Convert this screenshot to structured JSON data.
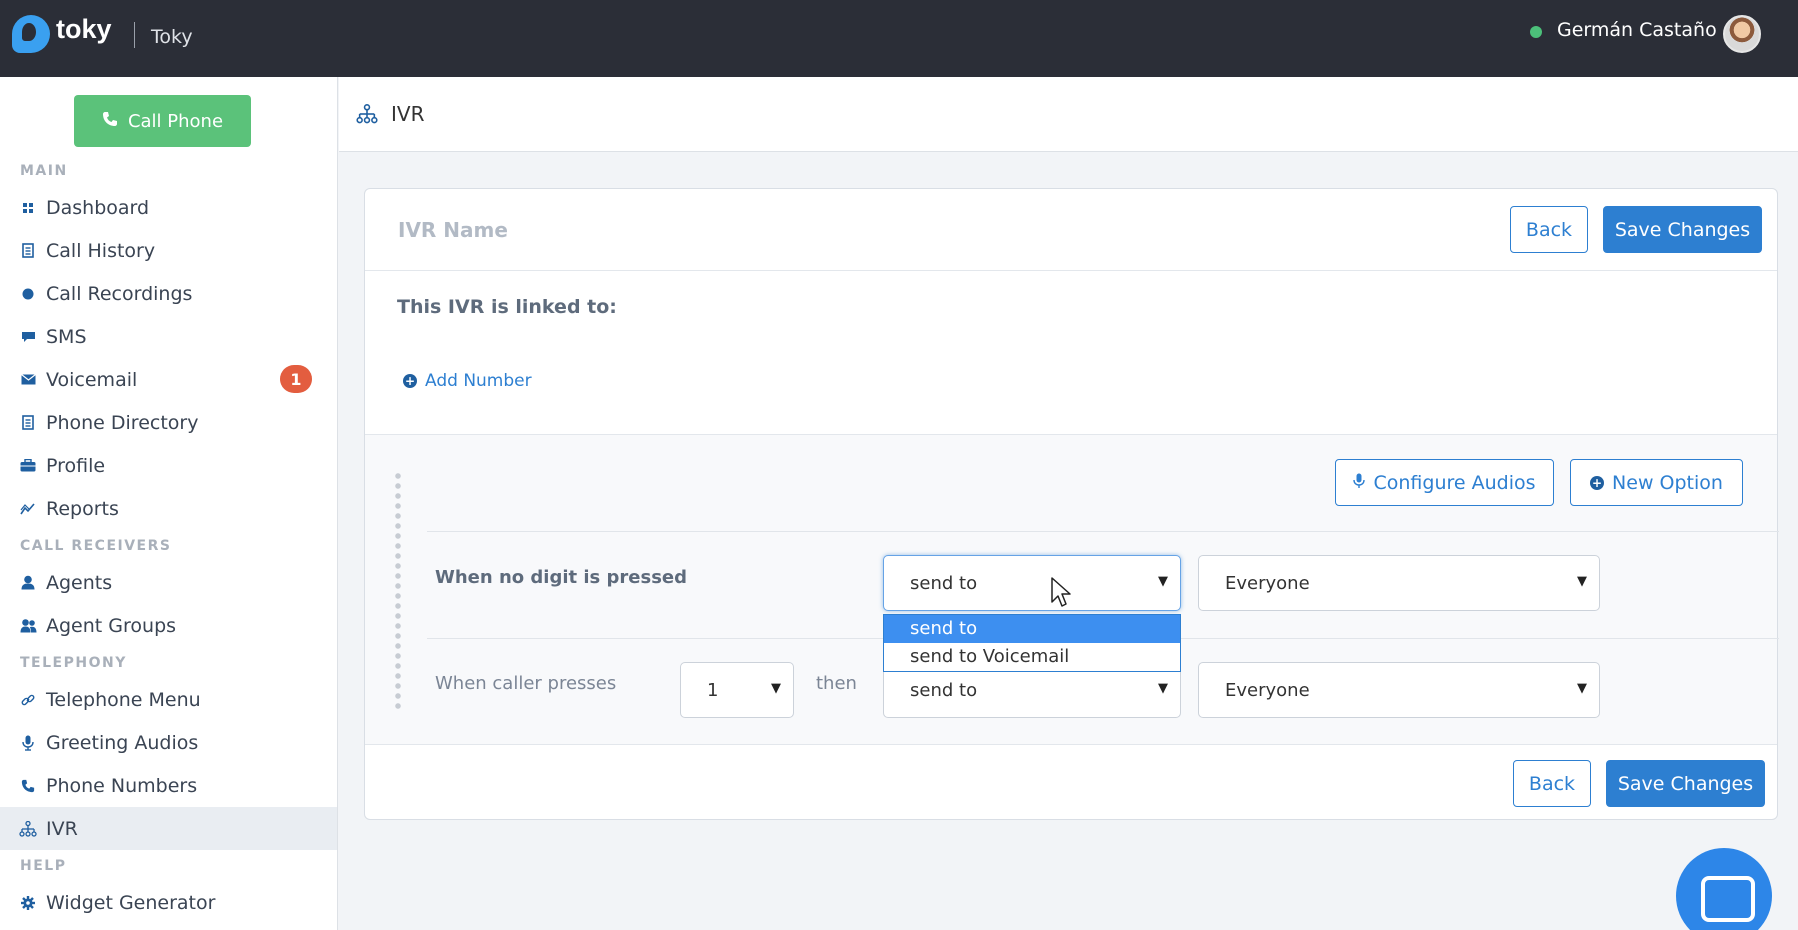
{
  "topbar": {
    "logo_text": "toky",
    "org_name": "Toky",
    "user_name": "Germán Castaño",
    "status_color": "#4cc07a"
  },
  "sidebar": {
    "call_button_label": "Call Phone",
    "sections": {
      "main": "MAIN",
      "call_receivers": "CALL RECEIVERS",
      "telephony": "TELEPHONY",
      "help": "HELP"
    },
    "items": [
      {
        "label": "Dashboard",
        "icon": "grid-icon"
      },
      {
        "label": "Call History",
        "icon": "document-icon"
      },
      {
        "label": "Call Recordings",
        "icon": "dot-icon"
      },
      {
        "label": "SMS",
        "icon": "chat-icon"
      },
      {
        "label": "Voicemail",
        "icon": "envelope-icon",
        "badge": "1"
      },
      {
        "label": "Phone Directory",
        "icon": "document-icon"
      },
      {
        "label": "Profile",
        "icon": "briefcase-icon"
      },
      {
        "label": "Reports",
        "icon": "chart-icon"
      },
      {
        "label": "Agents",
        "icon": "user-icon"
      },
      {
        "label": "Agent Groups",
        "icon": "users-icon"
      },
      {
        "label": "Telephone Menu",
        "icon": "link-icon"
      },
      {
        "label": "Greeting Audios",
        "icon": "microphone-icon"
      },
      {
        "label": "Phone Numbers",
        "icon": "phone-icon"
      },
      {
        "label": "IVR",
        "icon": "sitemap-icon",
        "active": true
      },
      {
        "label": "Widget Generator",
        "icon": "gear-icon"
      }
    ]
  },
  "page": {
    "title": "IVR"
  },
  "card": {
    "ivr_name_placeholder": "IVR Name",
    "back_label": "Back",
    "save_label": "Save Changes",
    "linked_title": "This IVR is linked to:",
    "add_number_label": "Add Number",
    "configure_audios_label": "Configure Audios",
    "new_option_label": "New Option",
    "rows": [
      {
        "label": "When no digit is pressed",
        "action": "send to",
        "target": "Everyone"
      },
      {
        "label": "When caller presses",
        "digit": "1",
        "then": "then",
        "action": "send to",
        "target": "Everyone"
      }
    ],
    "dropdown_options": [
      "send to",
      "send to Voicemail"
    ],
    "dropdown_selected": "send to"
  },
  "colors": {
    "primary": "#2d7fd1",
    "call_green": "#5bc27a",
    "badge_red": "#e35d3f",
    "topbar": "#2b2e37"
  }
}
